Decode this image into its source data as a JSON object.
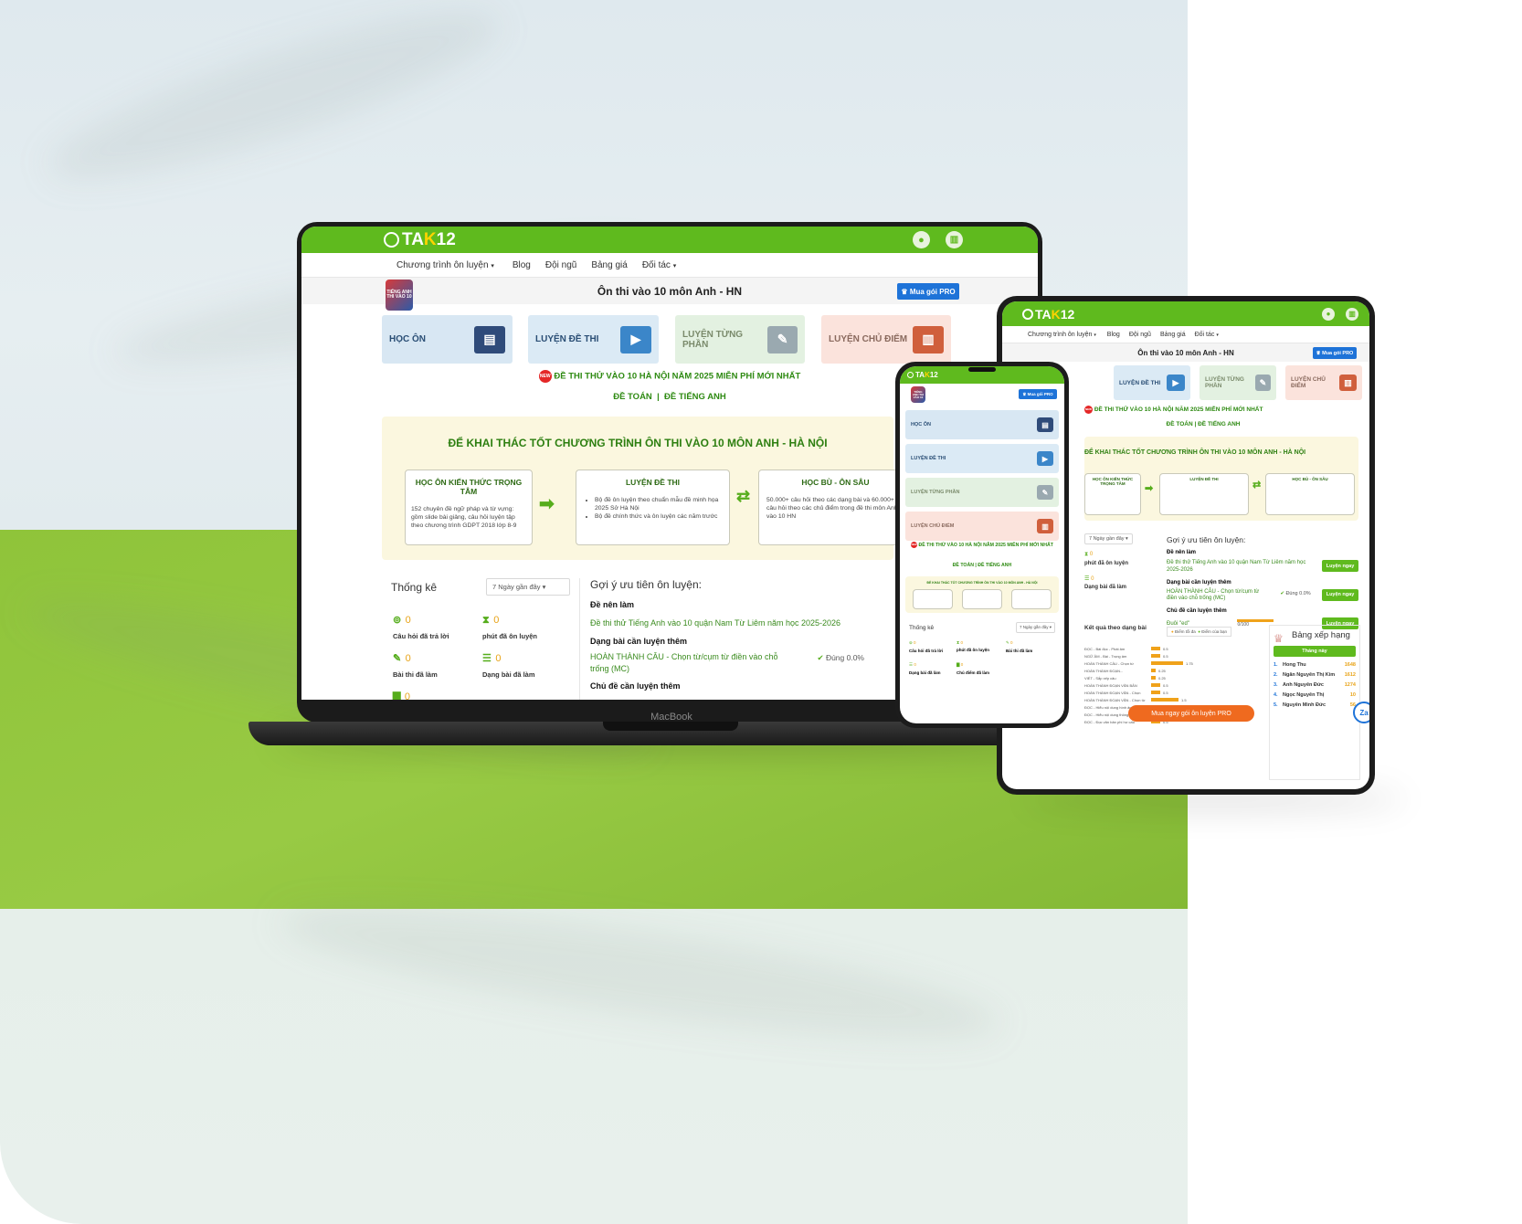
{
  "brand": {
    "logo_main": "TA",
    "logo_k": "K",
    "logo_num": "12",
    "green": "#5fba1e",
    "blue": "#1e73d8",
    "orange": "#ef6a1f"
  },
  "icons": {
    "user": "user-icon",
    "chart": "chart-icon",
    "caret": "caret-down-icon"
  },
  "nav": {
    "program": "Chương trình ôn luyện",
    "blog": "Blog",
    "team": "Đội ngũ",
    "pricing": "Bảng giá",
    "partner": "Đối tác"
  },
  "page": {
    "title": "Ôn thi vào 10 môn Anh - HN",
    "pro_button": "Mua gói PRO",
    "badge": "TIẾNG ANH THI VÀO 10"
  },
  "cards": [
    {
      "label": "HỌC ÔN"
    },
    {
      "label": "LUYỆN ĐỀ THI"
    },
    {
      "label": "LUYỆN TỪNG PHẦN"
    },
    {
      "label": "LUYỆN CHỦ ĐIỂM"
    }
  ],
  "notice": {
    "new_badge": "NEW",
    "text": "ĐỀ THI THỬ VÀO 10 HÀ NỘI NĂM 2025 MIỄN PHÍ MỚI NHẤT",
    "link_math": "ĐỀ TOÁN",
    "sep": "|",
    "link_english": "ĐỀ TIẾNG ANH"
  },
  "guide": {
    "title": "ĐỂ KHAI THÁC TỐT CHƯƠNG TRÌNH ÔN THI VÀO 10 MÔN ANH - HÀ NỘI",
    "box1_title": "HỌC ÔN KIẾN THỨC TRỌNG TÂM",
    "box1_text": "152 chuyên đề ngữ pháp và từ vựng: gồm slide bài giảng, câu hỏi luyện tập theo chương trình GDPT 2018 lớp 8-9",
    "box2_title": "LUYỆN ĐỀ THI",
    "box2_item1": "Bộ đề ôn luyện theo chuẩn mẫu đề minh họa 2025 Sở Hà Nội",
    "box2_item2": "Bộ đề chính thức và ôn luyện các năm trước",
    "box3_title": "HỌC BÙ - ÔN SÂU",
    "box3_text": "50.000+ câu hỏi theo các dạng bài và 60.000+ câu hỏi theo các chủ điểm trong đề thi môn Anh vào 10 HN"
  },
  "stats": {
    "title": "Thống kê",
    "range": "7 Ngày gần đây",
    "answered_val": "0",
    "answered": "Câu hỏi đã trả lời",
    "minutes_val": "0",
    "minutes": "phút đã ôn luyện",
    "tests_val": "0",
    "tests": "Bài thi đã làm",
    "types_val": "0",
    "types": "Dạng bài đã làm",
    "topics_val": "0",
    "topics": "Chủ điểm đã làm"
  },
  "suggest": {
    "title": "Gợi ý ưu tiên ôn luyện:",
    "exam_h": "Đề nên làm",
    "exam_link": "Đề thi thử Tiếng Anh vào 10 quận Nam Từ Liêm năm học 2025-2026",
    "type_h": "Dạng bài cần luyện thêm",
    "type_link": "HOÀN THÀNH CÂU - Chọn từ/cụm từ điền vào chỗ trống (MC)",
    "correct": "Đúng 0.0%",
    "topic_h": "Chủ đề cần luyện thêm",
    "topic_link": "Đuôi \"ed\"",
    "progress": "0/100",
    "go": "Luyện ngay"
  },
  "results": {
    "title": "Kết quả theo dạng bài",
    "legend_max": "Điểm tối đa",
    "legend_you": "Điểm của bạn",
    "rows": [
      {
        "label": "ĐỌC - Bài đọc - Phát âm",
        "val": "0.5"
      },
      {
        "label": "NGỮ ÂM - Bài - Trọng âm",
        "val": "0.5"
      },
      {
        "label": "HOÀN THÀNH CÂU - Chọn từ",
        "val": "1.75"
      },
      {
        "label": "HOÀN THÀNH ĐOẠN...",
        "val": "0.25"
      },
      {
        "label": "VIẾT - Sắp xếp câu",
        "val": "0.25"
      },
      {
        "label": "HOÀN THÀNH ĐOẠN VĂN BẢN",
        "val": "0.5"
      },
      {
        "label": "HOÀN THÀNH ĐOẠN VĂN - Chọn",
        "val": "0.5"
      },
      {
        "label": "HOÀN THÀNH ĐOẠN VĂN - Chọn từ",
        "val": "1.5"
      },
      {
        "label": "ĐỌC - Hiểu nội dung hình ảnh",
        "val": "0.25"
      },
      {
        "label": "ĐỌC - Hiểu nội dung thông báo",
        "val": "0.25"
      },
      {
        "label": "ĐỌC - Đọc văn bản phi hư cấu",
        "val": "0.5"
      }
    ]
  },
  "ranking": {
    "title": "Bảng xếp hạng",
    "tab": "Tháng này",
    "rows": [
      {
        "rank": "1.",
        "name": "Hong Thu",
        "score": "1648"
      },
      {
        "rank": "2.",
        "name": "Ngân Nguyễn Thị Kim",
        "score": "1612"
      },
      {
        "rank": "3.",
        "name": "Anh Nguyễn Đức",
        "score": "1274"
      },
      {
        "rank": "4.",
        "name": "Ngọc Nguyễn Thị",
        "score": "10"
      },
      {
        "rank": "5.",
        "name": "Nguyễn Minh Đức",
        "score": "56"
      }
    ]
  },
  "cta": {
    "buy_pro": "Mua ngay gói ôn luyện PRO",
    "zalo": "Za"
  },
  "device": {
    "laptop_brand": "MacBook"
  }
}
